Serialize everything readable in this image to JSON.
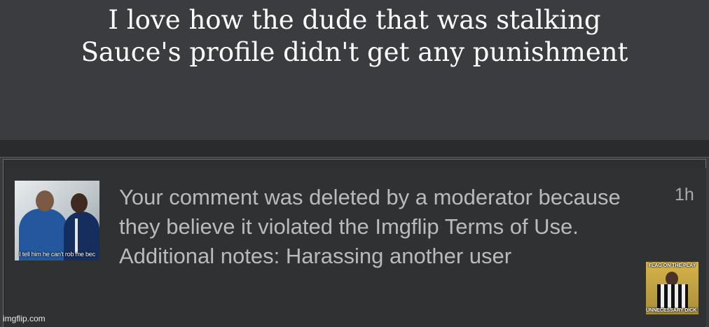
{
  "caption": {
    "text": "I love how the dude that was stalking\nSauce's profile didn't get any punishment"
  },
  "notification": {
    "thumbnail_caption": "I tell him he can't rob me bec",
    "message": "Your comment was deleted by a moderator because they believe it violated the Imgflip Terms of Use. Additional notes: Harassing another user",
    "time": "1h",
    "referee_top_text": "FLAG ON THE PLAY",
    "referee_bottom_text": "UNNECESSARY DICK RIDING"
  },
  "watermark": "imgflip.com"
}
